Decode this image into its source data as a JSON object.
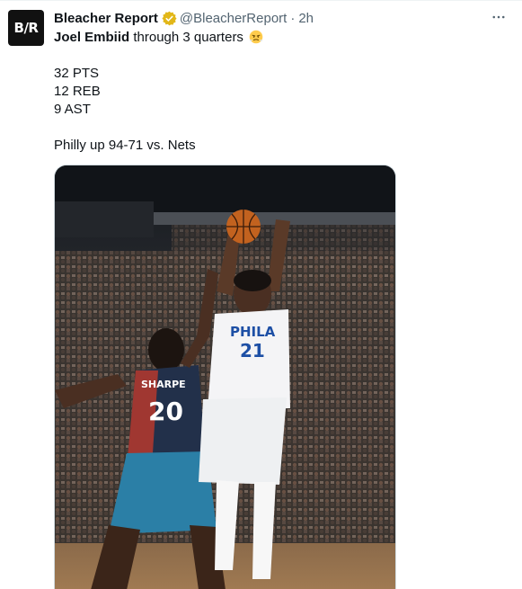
{
  "tweet": {
    "avatar_text": "B/R",
    "author_name": "Bleacher Report",
    "handle": "@BleacherReport",
    "separator": "·",
    "time": "2h",
    "mention": "Joel Embiid",
    "first_line_rest": " through 3 quarters",
    "emoji_icon": "face-with-steam-icon",
    "stats": [
      "32 PTS",
      "12 REB",
      "9 AST"
    ],
    "score_line": "Philly up 94-71 vs. Nets",
    "more_icon": "more-horizontal-icon",
    "verified_icon": "verified-badge-icon"
  },
  "photo": {
    "jersey_front_team": "PHILA",
    "jersey_front_number": "21",
    "jersey_defender_name": "SHARPE",
    "jersey_defender_number": "20"
  },
  "colors": {
    "verified_gold": "#e2b719",
    "secondary_text": "#536471",
    "primary_text": "#0f1419"
  }
}
